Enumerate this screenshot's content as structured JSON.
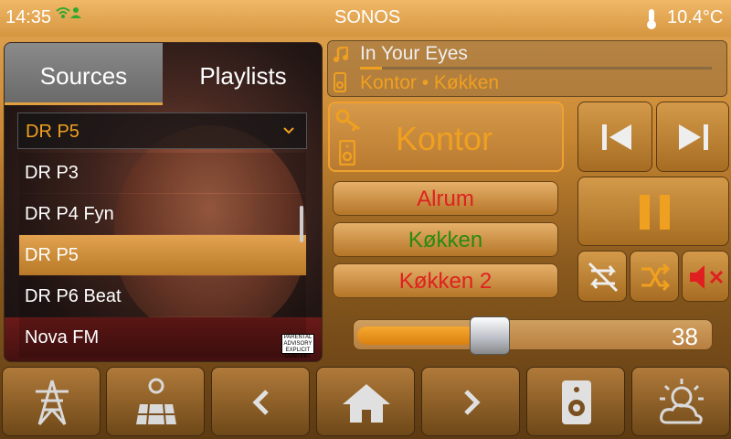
{
  "status": {
    "time": "14:35",
    "title": "SONOS",
    "temperature": "10.4°C"
  },
  "media": {
    "tabs": [
      {
        "label": "Sources"
      },
      {
        "label": "Playlists"
      }
    ],
    "selected_source": "DR P5",
    "sources": [
      "DR P3",
      "DR P4 Fyn",
      "DR P5",
      "DR P6 Beat",
      "Nova FM"
    ],
    "selected_index": 2,
    "advisory": "PARENTAL ADVISORY EXPLICIT CONTENT"
  },
  "now_playing": {
    "track": "In Your Eyes",
    "rooms": "Kontor • Køkken"
  },
  "zone": {
    "active": "Kontor"
  },
  "zones": [
    {
      "label": "Alrum",
      "color": "#e02020"
    },
    {
      "label": "Køkken",
      "color": "#2a8a10"
    },
    {
      "label": "Køkken 2",
      "color": "#e02020"
    }
  ],
  "volume": {
    "value": "38"
  },
  "colors": {
    "accent": "#f0a020",
    "mute": "#e02020"
  },
  "icons": [
    "wifi-icon",
    "thermometer-icon",
    "music-note-icon",
    "speaker-icon",
    "key-icon",
    "previous-icon",
    "next-icon",
    "pause-icon",
    "repeat-off-icon",
    "shuffle-icon",
    "mute-icon",
    "power-pylon-icon",
    "solar-panel-icon",
    "chevron-left-icon",
    "home-icon",
    "chevron-right-icon",
    "speaker-icon",
    "weather-icon"
  ]
}
